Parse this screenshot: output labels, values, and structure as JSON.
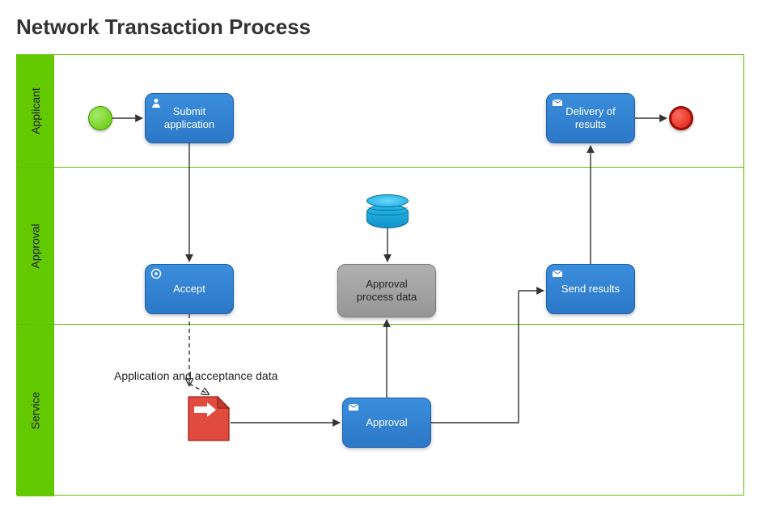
{
  "title": "Network Transaction Process",
  "lanes": {
    "applicant": "Applicant",
    "approval": "Approval",
    "service": "Service"
  },
  "tasks": {
    "submit": "Submit application",
    "deliver": "Delivery of results",
    "accept": "Accept",
    "approval_data": "Approval process data",
    "send_results": "Send results",
    "approval": "Approval"
  },
  "annotations": {
    "app_accept_data": "Application and acceptance data"
  },
  "icons": {
    "user": "user-icon",
    "envelope": "envelope-icon",
    "gear": "gear-icon",
    "arrow_doc": "arrow-doc-icon"
  }
}
